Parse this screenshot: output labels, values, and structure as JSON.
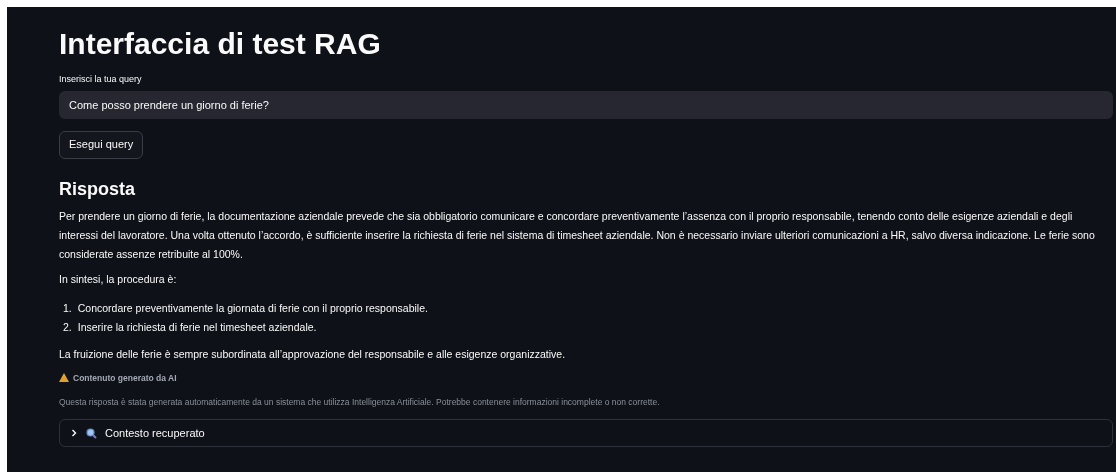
{
  "title": "Interfaccia di test RAG",
  "query": {
    "label": "Inserisci la tua query",
    "value": "Come posso prendere un giorno di ferie?"
  },
  "run_button": "Esegui query",
  "answer": {
    "heading": "Risposta",
    "paragraphs": [
      "Per prendere un giorno di ferie, la documentazione aziendale prevede che sia obbligatorio comunicare e concordare preventivamente l’assenza con il proprio responsabile, tenendo conto delle esigenze aziendali e degli interessi del lavoratore. Una volta ottenuto l’accordo, è sufficiente inserire la richiesta di ferie nel sistema di timesheet aziendale. Non è necessario inviare ulteriori comunicazioni a HR, salvo diversa indicazione. Le ferie sono considerate assenze retribuite al 100%.",
      "In sintesi, la procedura è:"
    ],
    "steps": [
      {
        "number": "1.",
        "text": "Concordare preventivamente la giornata di ferie con il proprio responsabile."
      },
      {
        "number": "2.",
        "text": "Inserire la richiesta di ferie nel timesheet aziendale."
      }
    ],
    "closing": "La fruizione delle ferie è sempre subordinata all’approvazione del responsabile e alle esigenze organizzative."
  },
  "warning": {
    "title": "Contenuto generato da AI",
    "text": "Questa risposta è stata generata automaticamente da un sistema che utilizza Intelligenza Artificiale. Potrebbe contenere informazioni incomplete o non corrette."
  },
  "expander": {
    "label": "Contesto recuperato",
    "expanded": false
  }
}
